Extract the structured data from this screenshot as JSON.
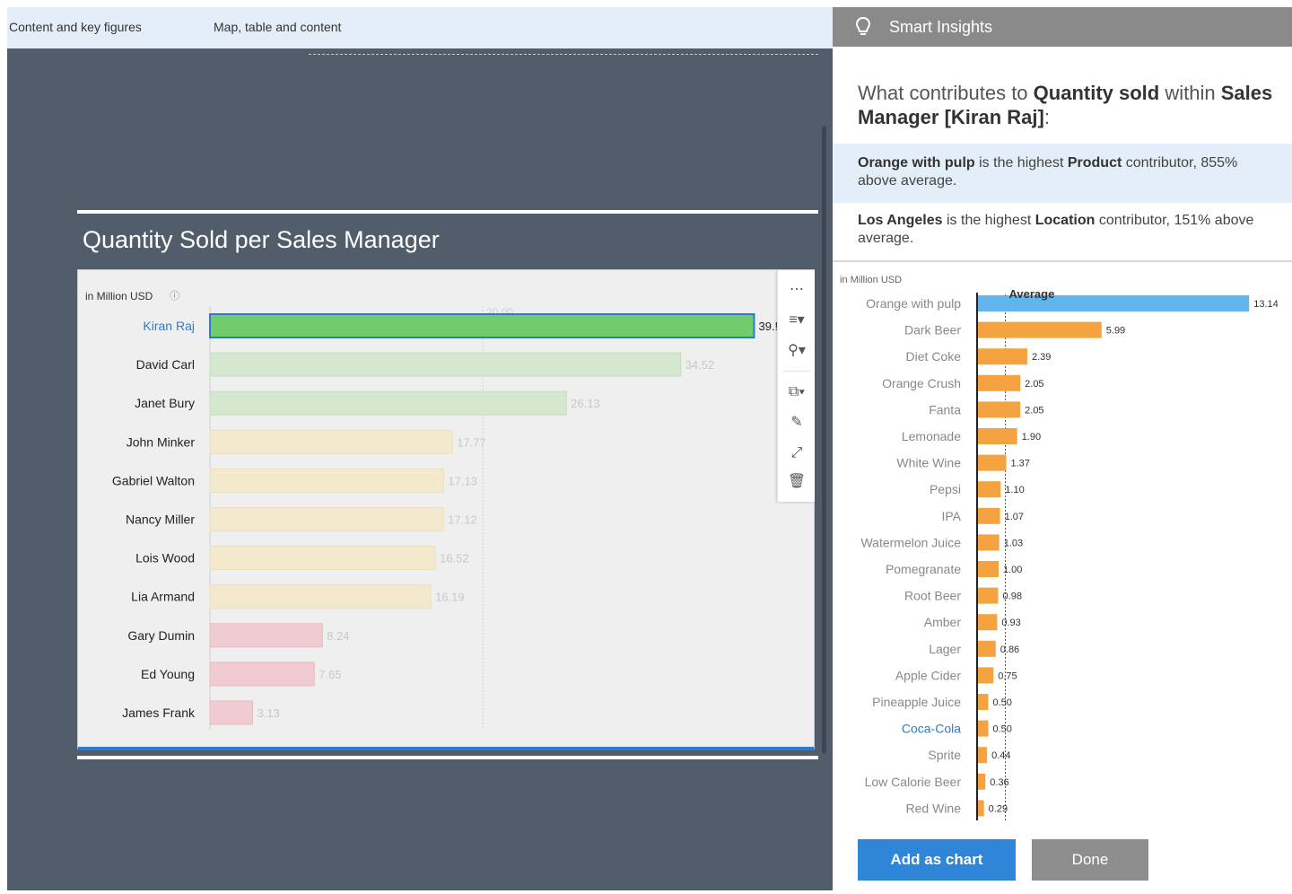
{
  "tabs": {
    "tab1": "Content and key figures",
    "tab2": "Map, table and content"
  },
  "main_chart": {
    "title": "Quantity Sold per Sales Manager",
    "unit": "in Million USD",
    "toolbar_icons": [
      "more-icon",
      "sort-icon",
      "ranking-icon",
      "copy-icon",
      "comment-icon",
      "fullscreen-icon",
      "delete-icon"
    ]
  },
  "panel": {
    "title": "Smart Insights",
    "question_part1": "What contributes to ",
    "question_bold1": "Quantity sold",
    "question_part2": " within ",
    "question_bold2": "Sales Manager [Kiran Raj]",
    "question_part3": ":",
    "insight1_bold1": "Orange with pulp",
    "insight1_text1": " is the highest ",
    "insight1_bold2": "Product",
    "insight1_text2": " contributor, 855% above average.",
    "insight2_bold1": "Los Angeles",
    "insight2_text1": " is the highest ",
    "insight2_bold2": "Location",
    "insight2_text2": " contributor, 151% above average.",
    "contrib_unit": "in Million USD",
    "add_button": "Add as chart",
    "done_button": "Done"
  },
  "colors": {
    "selected_bar": "#72cc6c",
    "green_bar": "#d4e8cf",
    "yellow_bar": "#f3e9cd",
    "red_bar": "#f0ccd2",
    "top_contributor": "#62b4ec",
    "contributor": "#f5a341"
  },
  "chart_data": [
    {
      "type": "bar",
      "title": "Quantity Sold per Sales Manager",
      "unit": "in Million USD",
      "reference_label": "20.00",
      "reference_value": 20,
      "categories": [
        "Kiran Raj",
        "David Carl",
        "Janet Bury",
        "John Minker",
        "Gabriel Walton",
        "Nancy Miller",
        "Lois Wood",
        "Lia Armand",
        "Gary Dumin",
        "Ed Young",
        "James Frank"
      ],
      "values": [
        39.9,
        34.52,
        26.13,
        17.77,
        17.13,
        17.12,
        16.52,
        16.19,
        8.24,
        7.65,
        3.13
      ],
      "labels": [
        "39.!",
        "34.52",
        "26.13",
        "17.77",
        "17.13",
        "17.12",
        "16.52",
        "16.19",
        "8.24",
        "7.65",
        "3.13"
      ],
      "selected": "Kiran Raj"
    },
    {
      "type": "bar",
      "unit": "in Million USD",
      "average_label": "Average",
      "average_value": 1.37,
      "categories": [
        "Orange with pulp",
        "Dark Beer",
        "Diet Coke",
        "Orange Crush",
        "Fanta",
        "Lemonade",
        "White Wine",
        "Pepsi",
        "IPA",
        "Watermelon Juice",
        "Pomegranate",
        "Root Beer",
        "Amber",
        "Lager",
        "Apple Cider",
        "Pineapple Juice",
        "Coca-Cola",
        "Sprite",
        "Low Calorie Beer",
        "Red Wine"
      ],
      "values": [
        13.14,
        5.99,
        2.39,
        2.05,
        2.05,
        1.9,
        1.37,
        1.1,
        1.07,
        1.03,
        1.0,
        0.98,
        0.93,
        0.86,
        0.75,
        0.5,
        0.5,
        0.44,
        0.36,
        0.29
      ],
      "labels": [
        "13.14",
        "5.99",
        "2.39",
        "2.05",
        "2.05",
        "1.90",
        "1.37",
        "1.10",
        "1.07",
        "1.03",
        "1.00",
        "0.98",
        "0.93",
        "0.86",
        "0.75",
        "0.50",
        "0.50",
        "0.44",
        "0.36",
        "0.29"
      ],
      "highlighted": "Coca-Cola"
    }
  ]
}
